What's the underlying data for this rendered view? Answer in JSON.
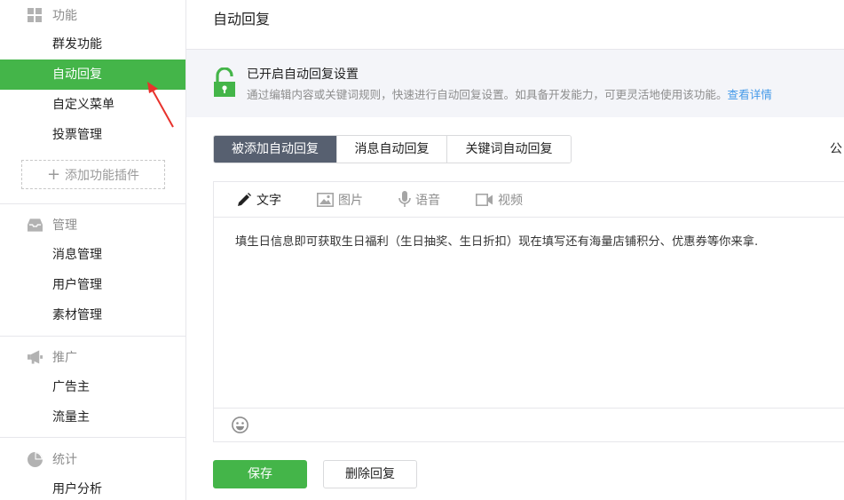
{
  "sidebar": {
    "sections": [
      {
        "title": "功能",
        "icon": "grid-icon",
        "items": [
          {
            "label": "群发功能"
          },
          {
            "label": "自动回复",
            "active": true
          },
          {
            "label": "自定义菜单"
          },
          {
            "label": "投票管理"
          }
        ]
      },
      {
        "title": "管理",
        "icon": "inbox-icon",
        "items": [
          {
            "label": "消息管理"
          },
          {
            "label": "用户管理"
          },
          {
            "label": "素材管理"
          }
        ]
      },
      {
        "title": "推广",
        "icon": "megaphone-icon",
        "items": [
          {
            "label": "广告主"
          },
          {
            "label": "流量主"
          }
        ]
      },
      {
        "title": "统计",
        "icon": "pie-chart-icon",
        "items": [
          {
            "label": "用户分析"
          }
        ]
      }
    ],
    "add_plugin": "添加功能插件"
  },
  "main": {
    "title": "自动回复",
    "notice": {
      "title": "已开启自动回复设置",
      "desc": "通过编辑内容或关键词规则，快速进行自动回复设置。如具备开发能力，可更灵活地使用该功能。",
      "link": "查看详情"
    },
    "tabs": [
      {
        "label": "被添加自动回复",
        "active": true
      },
      {
        "label": "消息自动回复"
      },
      {
        "label": "关键词自动回复"
      }
    ],
    "right_cut": "公",
    "editor": {
      "tools": [
        {
          "label": "文字",
          "icon": "pencil-icon",
          "active": true
        },
        {
          "label": "图片",
          "icon": "image-icon"
        },
        {
          "label": "语音",
          "icon": "microphone-icon"
        },
        {
          "label": "视频",
          "icon": "video-icon"
        }
      ],
      "content": "填生日信息即可获取生日福利（生日抽奖、生日折扣）现在填写还有海量店铺积分、优惠券等你来拿."
    },
    "buttons": {
      "save": "保存",
      "delete": "删除回复"
    }
  },
  "colors": {
    "accent": "#44b549",
    "tab_active": "#576070",
    "link": "#459ae9",
    "annotation": "#e8322c"
  }
}
